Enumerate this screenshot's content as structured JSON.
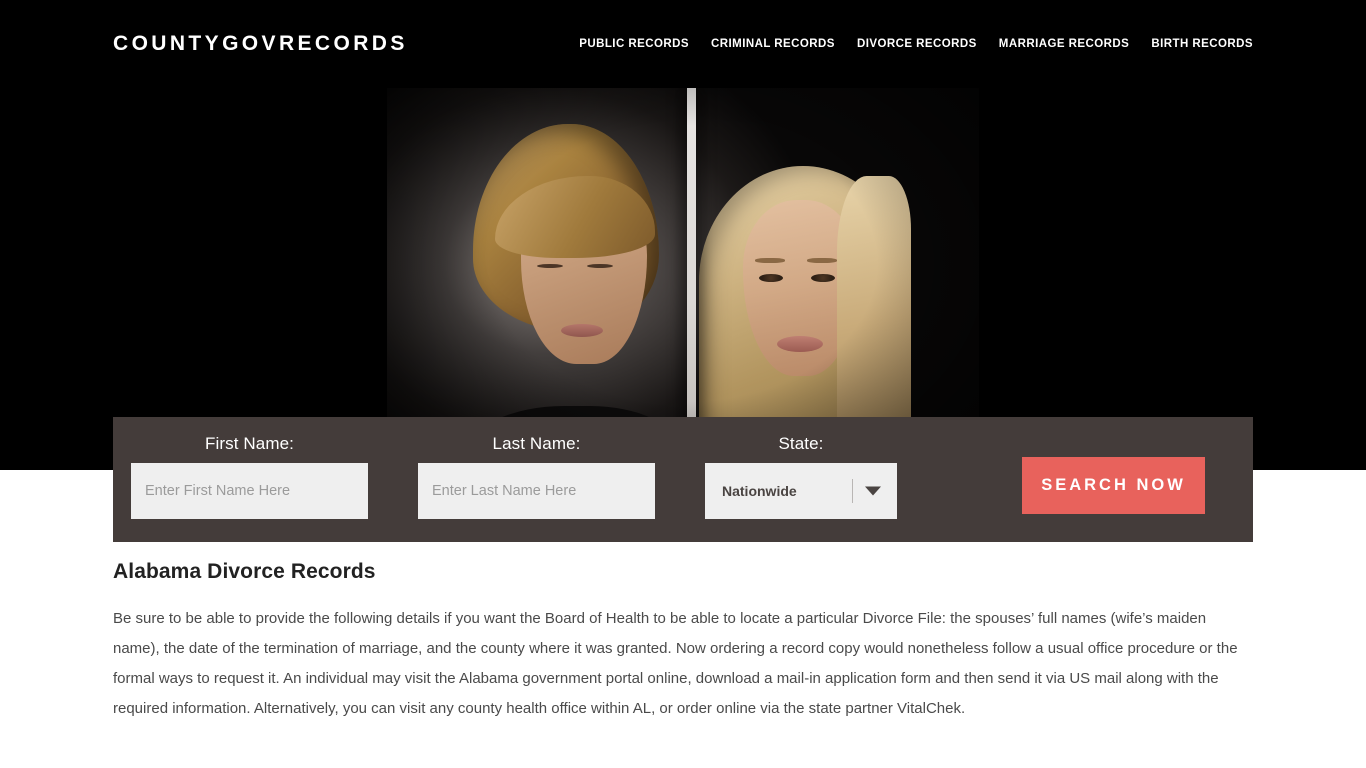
{
  "header": {
    "brand": "COUNTYGOVRECORDS",
    "nav": [
      {
        "label": "PUBLIC RECORDS"
      },
      {
        "label": "CRIMINAL RECORDS"
      },
      {
        "label": "DIVORCE RECORDS"
      },
      {
        "label": "MARRIAGE RECORDS"
      },
      {
        "label": "BIRTH RECORDS"
      }
    ]
  },
  "hero": {
    "image_alt": "Couple separated by a white vertical divider"
  },
  "search": {
    "first_name": {
      "label": "First Name:",
      "placeholder": "Enter First Name Here",
      "value": ""
    },
    "last_name": {
      "label": "Last Name:",
      "placeholder": "Enter Last Name Here",
      "value": ""
    },
    "state": {
      "label": "State:",
      "selected": "Nationwide"
    },
    "submit_label": "SEARCH NOW"
  },
  "content": {
    "title": "Alabama Divorce Records",
    "body": "Be sure to be able to provide the following details if you want the Board of Health to be able to locate a particular Divorce File: the spouses’ full names (wife’s maiden name), the date of the termination of marriage, and the county where it was granted. Now ordering a record copy would nonetheless follow a usual office procedure or the formal ways to request it. An individual may visit the Alabama government portal online, download a mail-in application form and then send it via US mail along with the required information. Alternatively, you can visit any county health office within AL, or order online via the state partner VitalChek."
  },
  "colors": {
    "header_bg": "#000000",
    "panel_bg": "#443c3a",
    "accent": "#e8625c",
    "input_bg": "#efefef",
    "page_bg": "#ffffff"
  }
}
